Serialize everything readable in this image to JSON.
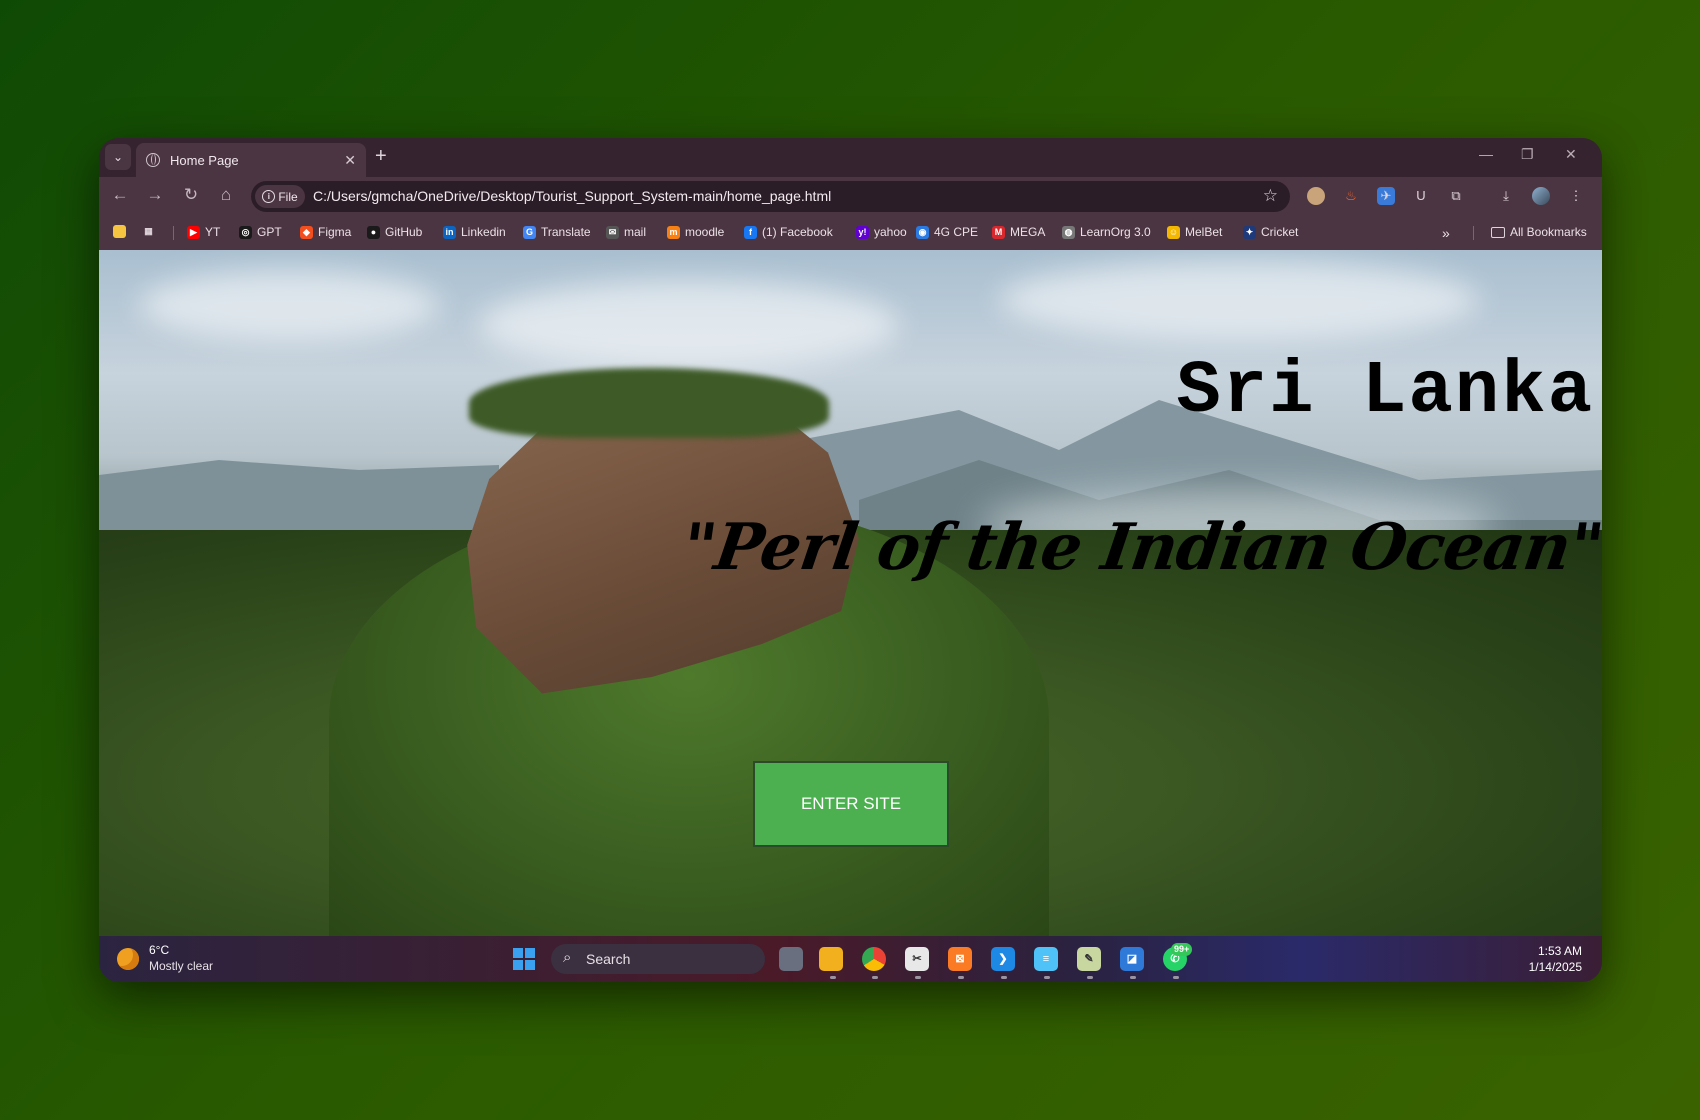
{
  "tab": {
    "title": "Home Page",
    "close": "✕",
    "new_tab": "+"
  },
  "window_controls": {
    "minimize": "—",
    "restore": "❐",
    "close": "✕"
  },
  "omnibox": {
    "chip": "File",
    "url": "C:/Users/gmcha/OneDrive/Desktop/Tourist_Support_System-main/home_page.html"
  },
  "bookmarks": [
    {
      "label": "YT",
      "icon": "youtube-icon",
      "color": "#ff0000"
    },
    {
      "label": "GPT",
      "icon": "chatgpt-icon",
      "color": "#1a1a1a"
    },
    {
      "label": "Figma",
      "icon": "figma-icon",
      "color": "#f24e1e"
    },
    {
      "label": "GitHub",
      "icon": "github-icon",
      "color": "#1a1a1a"
    },
    {
      "label": "Linkedin",
      "icon": "linkedin-icon",
      "color": "#0a66c2"
    },
    {
      "label": "Translate",
      "icon": "translate-icon",
      "color": "#4285f4"
    },
    {
      "label": "mail",
      "icon": "mail-icon",
      "color": "#555555"
    },
    {
      "label": "moodle",
      "icon": "moodle-icon",
      "color": "#f98012"
    },
    {
      "label": "(1) Facebook",
      "icon": "facebook-icon",
      "color": "#1877f2"
    },
    {
      "label": "yahoo",
      "icon": "yahoo-icon",
      "color": "#6001d2"
    },
    {
      "label": "4G CPE",
      "icon": "router-icon",
      "color": "#2a7ae2"
    },
    {
      "label": "MEGA",
      "icon": "mega-icon",
      "color": "#d9272e"
    },
    {
      "label": "LearnOrg 3.0",
      "icon": "globe-icon",
      "color": "#777777"
    },
    {
      "label": "MelBet",
      "icon": "melbet-icon",
      "color": "#f5b800"
    },
    {
      "label": "Cricket",
      "icon": "cricket-icon",
      "color": "#1f3a7a"
    }
  ],
  "all_bookmarks": "All Bookmarks",
  "overflow": "»",
  "page": {
    "heading": "Sri Lanka",
    "tagline": "\"Perl of the Indian Ocean\"",
    "enter_button": "ENTER SITE",
    "button_color": "#4caf50"
  },
  "taskbar": {
    "weather_temp": "6°C",
    "weather_desc": "Mostly clear",
    "search_label": "Search",
    "time": "1:53 AM",
    "date": "1/14/2025",
    "badge": "99+"
  }
}
